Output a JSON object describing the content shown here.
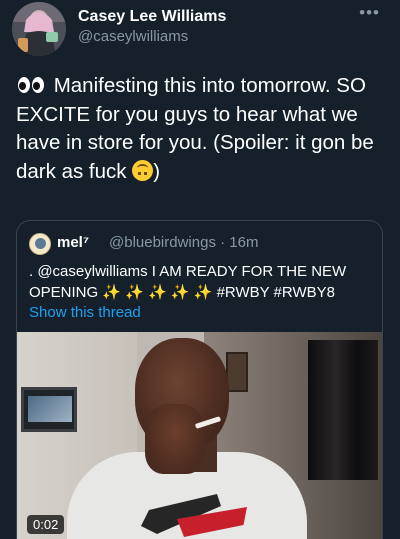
{
  "tweet": {
    "display_name": "Casey Lee Williams",
    "handle": "@caseylwilliams",
    "text_before_emoji": "Manifesting this into tomorrow. SO EXCITE for you guys to hear what we have in store for you. (Spoiler: it gon be dark as fuck ",
    "text_after_emoji": ")",
    "emoji_lead": "eyes-icon",
    "emoji_inline": "upside-down-face-icon",
    "more_icon": "more-horizontal-icon"
  },
  "quote": {
    "display_name": "mel⁷",
    "handle_time": "@bluebirdwings · 16m",
    "text": ". @caseylwilliams I AM READY FOR THE NEW OPENING ✨ ✨ ✨ ✨ ✨ #RWBY #RWBY8",
    "show_thread": "Show this thread",
    "video_duration": "0:02"
  },
  "colors": {
    "background": "#15202b",
    "secondary_text": "#8899a6",
    "link": "#1da1f2",
    "border": "#38444d"
  }
}
